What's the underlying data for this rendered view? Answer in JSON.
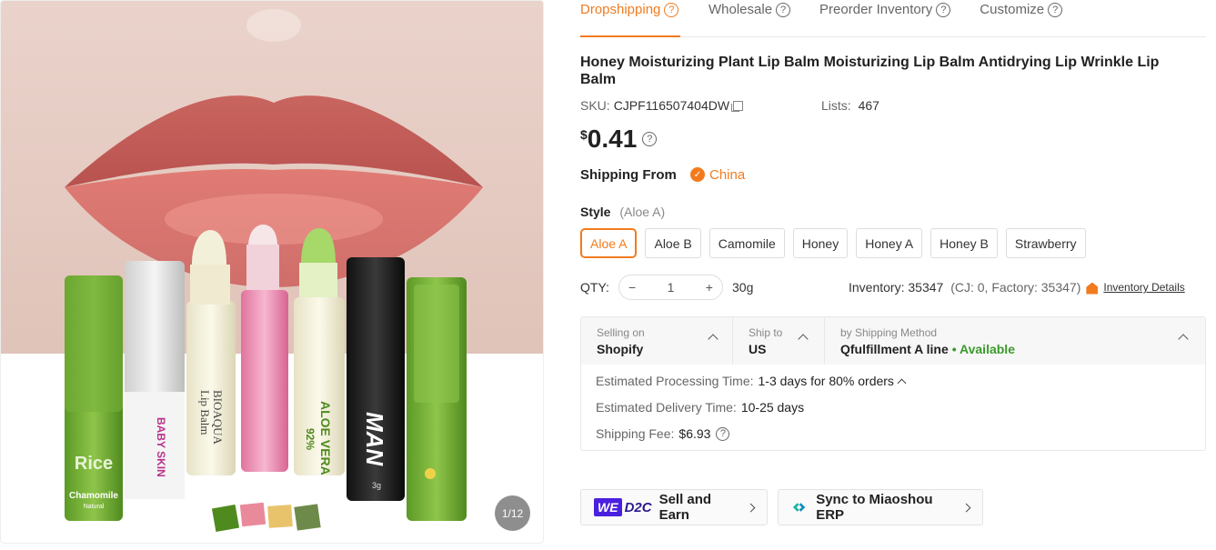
{
  "gallery": {
    "counter": "1/12",
    "product_labels": {
      "rice": "Rice",
      "rice_sub": "Chamomile",
      "rice_sub2": "Natural",
      "baby_skin": "BABY SKIN",
      "bioaqua": "BIOAQUA",
      "lip_balm": "Lip Balm",
      "aloe_pct": "92%",
      "aloe_vera": "ALOE VERA",
      "man": "MAN",
      "man_weight": "3g"
    }
  },
  "tabs": [
    {
      "label": "Dropshipping",
      "active": true
    },
    {
      "label": "Wholesale",
      "active": false
    },
    {
      "label": "Preorder Inventory",
      "active": false
    },
    {
      "label": "Customize",
      "active": false
    }
  ],
  "product": {
    "title": "Honey Moisturizing Plant Lip Balm Moisturizing Lip Balm Antidrying Lip Wrinkle Lip Balm",
    "sku_label": "SKU:",
    "sku": "CJPF116507404DW",
    "lists_label": "Lists:",
    "lists": "467",
    "currency": "$",
    "price": "0.41"
  },
  "shipping_from": {
    "label": "Shipping From",
    "country": "China"
  },
  "style": {
    "label": "Style",
    "selected": "(Aloe A)",
    "options": [
      "Aloe A",
      "Aloe B",
      "Camomile",
      "Honey",
      "Honey A",
      "Honey B",
      "Strawberry"
    ]
  },
  "qty": {
    "label": "QTY:",
    "value": "1",
    "minus": "−",
    "plus": "+",
    "weight": "30g",
    "inventory_label": "Inventory:",
    "inventory": "35347",
    "inventory_breakdown": "(CJ: 0, Factory: 35347)",
    "details_link": "Inventory Details"
  },
  "shipping": {
    "selling_on_label": "Selling on",
    "selling_on": "Shopify",
    "ship_to_label": "Ship to",
    "ship_to": "US",
    "method_label": "by Shipping Method",
    "method": "Qfulfillment A line",
    "availability": "• Available",
    "processing_label": "Estimated Processing Time:",
    "processing": "1-3 days for 80% orders",
    "delivery_label": "Estimated Delivery Time:",
    "delivery": "10-25 days",
    "fee_label": "Shipping Fee:",
    "fee": "$6.93"
  },
  "actions": {
    "we_label": "WE",
    "d2c_label": "D2C",
    "sell_earn": "Sell and Earn",
    "sync_erp": "Sync to Miaoshou ERP"
  },
  "colors": {
    "accent": "#f27b1e",
    "available": "#3a9a2a",
    "we_brand": "#4b1fe0"
  }
}
